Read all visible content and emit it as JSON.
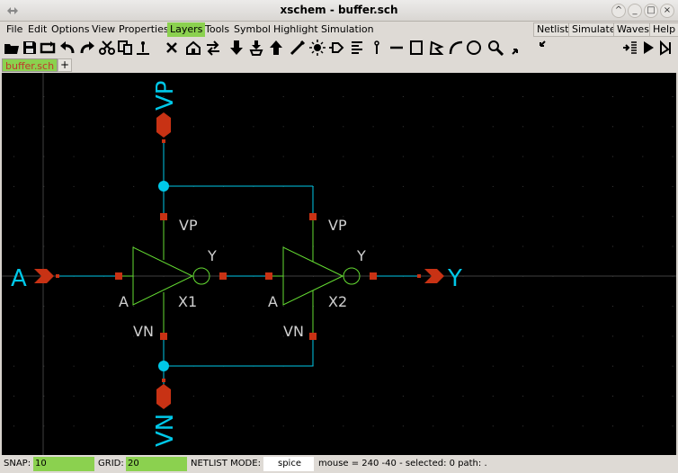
{
  "window": {
    "title": "xschem - buffer.sch"
  },
  "menu": {
    "items": [
      "File",
      "Edit",
      "Options",
      "View",
      "Properties",
      "Layers",
      "Tools",
      "Symbol",
      "Highlight",
      "Simulation"
    ],
    "active": "Layers",
    "right_items": [
      "Netlist",
      "Simulate",
      "Waves",
      "Help"
    ]
  },
  "toolbar": {
    "icons": [
      "open-icon",
      "save-icon",
      "reload-icon",
      "undo-icon",
      "redo-icon",
      "cut-icon",
      "copy-icon",
      "delete-icon",
      "place-symbol-icon",
      "swap-icon",
      "push-down-icon",
      "make-symbol-icon",
      "pop-up-icon",
      "wire-icon",
      "netlabel-icon",
      "pin-icon",
      "text-icon",
      "resistor-icon",
      "line-icon",
      "rectangle-icon",
      "polygon-icon",
      "arc-icon",
      "circle-icon",
      "search-icon",
      "zoom-full-icon",
      "zoom-in-icon"
    ],
    "right_icons": [
      "netlist-icon",
      "simulate-icon",
      "waves-icon"
    ]
  },
  "tabs": {
    "active": "buffer.sch",
    "add": "+"
  },
  "schematic": {
    "pins": {
      "in": "A",
      "out": "Y",
      "vp": "VP",
      "vn": "VN"
    },
    "instances": [
      {
        "name": "X1",
        "in_pin": "A",
        "out_pin": "Y",
        "vp_pin": "VP",
        "vn_pin": "VN"
      },
      {
        "name": "X2",
        "in_pin": "A",
        "out_pin": "Y",
        "vp_pin": "VP",
        "vn_pin": "VN"
      }
    ],
    "colors": {
      "wire": "#00c8e8",
      "pin": "#c83214",
      "symbol": "#64dc32",
      "label": "#d0d0d0",
      "grid": "#3a3a3a"
    }
  },
  "status": {
    "snap_label": "SNAP:",
    "snap": "10",
    "grid_label": "GRID:",
    "grid": "20",
    "netlist_label": "NETLIST MODE:",
    "netlist_mode": "spice",
    "info": "mouse = 240 -40 - selected: 0 path: ."
  }
}
